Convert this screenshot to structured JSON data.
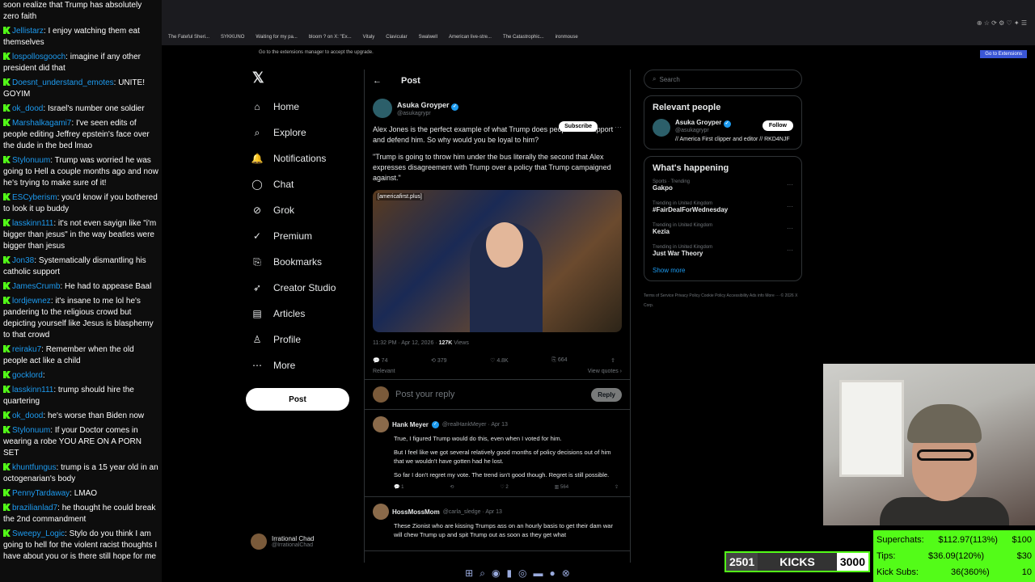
{
  "chat": [
    {
      "user": "",
      "msg": "soon realize that Trump has absolutely zero faith",
      "color": "#ffffff"
    },
    {
      "user": "Jellistarz",
      "msg": "I enjoy watching them eat themselves",
      "color": "#1d9bf0"
    },
    {
      "user": "lospollosgooch",
      "msg": "imagine if any other president did that",
      "color": "#1d9bf0"
    },
    {
      "user": "Doesnt_understand_emotes",
      "msg": "UNITE! GOYIM",
      "color": "#1d9bf0"
    },
    {
      "user": "ok_dood",
      "msg": "Israel's number one soldier",
      "color": "#1d9bf0"
    },
    {
      "user": "Marshalkagami7",
      "msg": "I've seen edits of people editing Jeffrey epstein's face over the dude in the bed lmao",
      "color": "#1d9bf0"
    },
    {
      "user": "Stylonuum",
      "msg": "Trump was worried he was going to Hell a couple months ago and now he's trying to make sure of it!",
      "color": "#1d9bf0"
    },
    {
      "user": "ESCyberism",
      "msg": "you'd know if you bothered to look it up buddy",
      "color": "#1d9bf0"
    },
    {
      "user": "lasskinn111",
      "msg": "it's not even sayign like \"i'm bigger than jesus\" in the way beatles were bigger than jesus",
      "color": "#1d9bf0"
    },
    {
      "user": "Jon38",
      "msg": "Systematically dismantling his catholic support",
      "color": "#1d9bf0"
    },
    {
      "user": "JamesCrumb",
      "msg": "He had to appease Baal",
      "color": "#1d9bf0"
    },
    {
      "user": "lordjewnez",
      "msg": "it's insane to me lol he's pandering to the religious crowd but depicting yourself like Jesus is blasphemy to that crowd",
      "color": "#1d9bf0"
    },
    {
      "user": "reiraku7",
      "msg": "Remember when the old people act like a child",
      "color": "#1d9bf0"
    },
    {
      "user": "gocklord",
      "msg": "",
      "color": "#1d9bf0"
    },
    {
      "user": "lasskinn111",
      "msg": "trump should hire the quartering",
      "color": "#1d9bf0"
    },
    {
      "user": "ok_dood",
      "msg": "he's worse than Biden now",
      "color": "#1d9bf0"
    },
    {
      "user": "Stylonuum",
      "msg": "If your Doctor comes in wearing a robe YOU ARE ON A PORN SET",
      "color": "#1d9bf0"
    },
    {
      "user": "khuntfungus",
      "msg": "trump is a 15 year old in an octogenarian's body",
      "color": "#1d9bf0"
    },
    {
      "user": "PennyTardaway",
      "msg": "LMAO",
      "color": "#1d9bf0"
    },
    {
      "user": "brazilianlad7",
      "msg": "he thought he could break the 2nd commandment",
      "color": "#1d9bf0"
    },
    {
      "user": "Sweepy_Logic",
      "msg": "Stylo do you think I am going to hell for the violent racist thoughts I have about you or is there still hope for me",
      "color": "#1d9bf0"
    }
  ],
  "bookmarks": [
    "The Fateful Sheri...",
    "SYKKUNO",
    "Waiting for my pa...",
    "bloom ? on X: \"Ex...",
    "Vitaly",
    "Clavicular",
    "Swalwell",
    "American live-stre...",
    "The Catastrophic...",
    "ironmouse"
  ],
  "ext_notice": "Go to the extensions manager to accept the upgrade.",
  "ext_button": "Go to Extensions",
  "nav": {
    "items": [
      {
        "label": "Home",
        "icon": "⌂"
      },
      {
        "label": "Explore",
        "icon": "⌕"
      },
      {
        "label": "Notifications",
        "icon": "🔔"
      },
      {
        "label": "Chat",
        "icon": "◯"
      },
      {
        "label": "Grok",
        "icon": "⊘"
      },
      {
        "label": "Premium",
        "icon": "✓"
      },
      {
        "label": "Bookmarks",
        "icon": "⎘"
      },
      {
        "label": "Creator Studio",
        "icon": "➶"
      },
      {
        "label": "Articles",
        "icon": "▤"
      },
      {
        "label": "Profile",
        "icon": "♙"
      },
      {
        "label": "More",
        "icon": "⋯"
      }
    ],
    "post": "Post",
    "account_name": "Irrational Chad",
    "account_handle": "@IrrationalChad"
  },
  "post": {
    "header": "Post",
    "author": "Asuka Groyper",
    "handle": "@asukagrypr",
    "subscribe": "Subscribe",
    "text1": "Alex Jones is the perfect example of what Trump does people who support and defend him. So why would you be loyal to him?",
    "text2": "\"Trump is going to throw him under the bus literally the second that Alex expresses disagreement with Trump over a policy that Trump campaigned against.\"",
    "media_caption": "[americafirst.plus]",
    "time": "11:32 PM · Apr 12, 2026 · ",
    "views": "127K",
    "views_label": "Views",
    "replies": "74",
    "reposts": "379",
    "likes": "4.8K",
    "bookmarks": "664",
    "relevant": "Relevant",
    "view_quotes": "View quotes ›",
    "reply_placeholder": "Post your reply",
    "reply_btn": "Reply"
  },
  "replies": [
    {
      "name": "Hank Meyer",
      "handle": "@realHankMeyer · Apr 13",
      "p1": "True, I figured Trump would do this, even when I voted for him.",
      "p2": "But I feel like we got several relatively good months of policy decisions out of him that we wouldn't have gotten had he lost.",
      "p3": "So far I don't regret my vote. The trend isn't good though. Regret is still possible.",
      "replies": "1",
      "likes": "2",
      "views": "564"
    },
    {
      "name": "HossMossMom",
      "handle": "@carla_sledge · Apr 13",
      "p1": "These Zionist who are kissing Trumps ass on an hourly basis to get their dam war will chew Trump up and spit Trump out as soon as they get what"
    }
  ],
  "right": {
    "search": "Search",
    "relevant_title": "Relevant people",
    "rp_name": "Asuka Groyper",
    "rp_handle": "@asukagrypr",
    "rp_bio": "// America First clipper and editor // RKD4NJF",
    "follow": "Follow",
    "happening_title": "What's happening",
    "trends": [
      {
        "ctx": "Sports · Trending",
        "t": "Gakpo"
      },
      {
        "ctx": "Trending in United Kingdom",
        "t": "#FairDealForWednesday"
      },
      {
        "ctx": "Trending in United Kingdom",
        "t": "Kezia"
      },
      {
        "ctx": "Trending in United Kingdom",
        "t": "Just War Theory"
      }
    ],
    "show_more": "Show more",
    "footer": "Terms of Service   Privacy Policy   Cookie Policy   Accessibility   Ads info   More ···   © 2026 X Corp."
  },
  "overlay": {
    "kicks_left": "2501",
    "kicks_label": "KICKS",
    "kicks_right": "3000",
    "goals": [
      {
        "label": "Superchats:",
        "value": "$112.97(113%)",
        "goal": "$100"
      },
      {
        "label": "Tips:",
        "value": "$36.09(120%)",
        "goal": "$30"
      },
      {
        "label": "Kick Subs:",
        "value": "36(360%)",
        "goal": "10"
      }
    ]
  }
}
